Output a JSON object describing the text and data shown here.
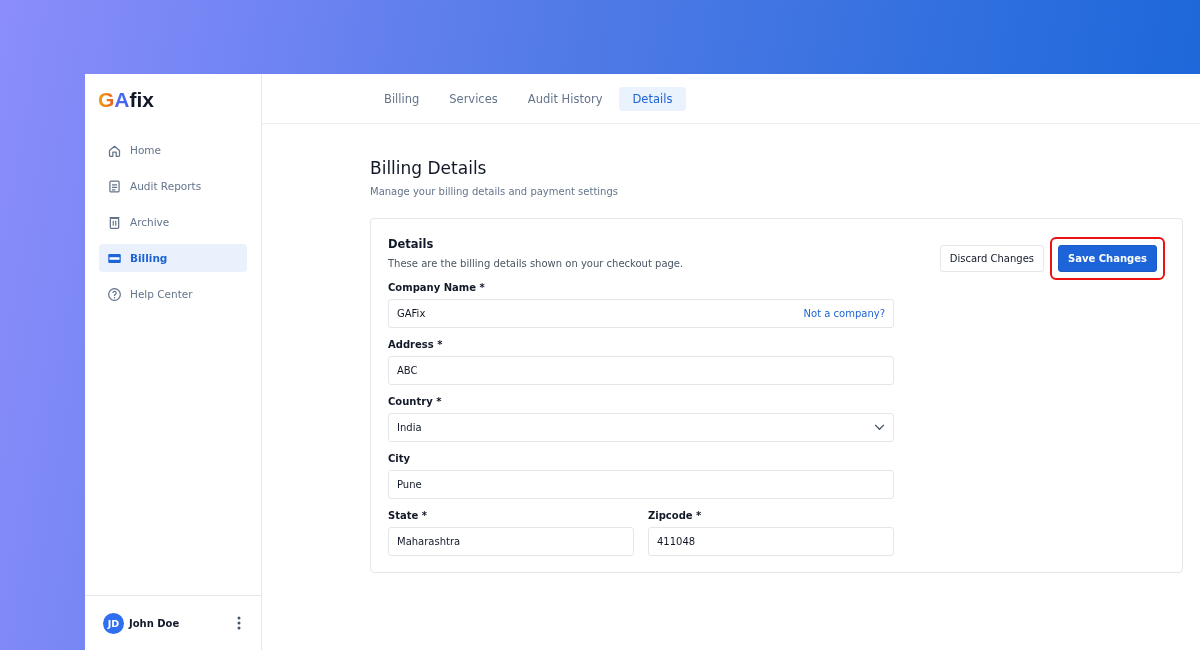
{
  "logo": {
    "mark": "GA",
    "word": "fix"
  },
  "sidebar": {
    "items": [
      {
        "label": "Home",
        "kind": "home",
        "selected": false
      },
      {
        "label": "Audit Reports",
        "kind": "doc",
        "selected": false
      },
      {
        "label": "Archive",
        "kind": "trash",
        "selected": false
      },
      {
        "label": "Billing",
        "kind": "card",
        "selected": true
      },
      {
        "label": "Help Center",
        "kind": "help",
        "selected": false
      }
    ],
    "user": {
      "initials": "JD",
      "name": "John Doe"
    }
  },
  "tabs": [
    {
      "label": "Billing",
      "selected": false
    },
    {
      "label": "Services",
      "selected": false
    },
    {
      "label": "Audit History",
      "selected": false
    },
    {
      "label": "Details",
      "selected": true
    }
  ],
  "page": {
    "title": "Billing Details",
    "subtitle": "Manage your billing details and payment settings"
  },
  "card": {
    "title": "Details",
    "description": "These are the billing details shown on your checkout page.",
    "buttons": [
      {
        "label": "Discard Changes",
        "kind": "secondary",
        "highlighted": false
      },
      {
        "label": "Save Changes",
        "kind": "primary",
        "highlighted": true
      }
    ],
    "rows": [
      [
        {
          "kind": "text",
          "label": "Company Name *",
          "value": "GAFix",
          "link": "Not a company?"
        }
      ],
      [
        {
          "kind": "text",
          "label": "Address *",
          "value": "ABC"
        }
      ],
      [
        {
          "kind": "select",
          "label": "Country *",
          "value": "India"
        }
      ],
      [
        {
          "kind": "text",
          "label": "City",
          "value": "Pune"
        }
      ],
      [
        {
          "kind": "text",
          "label": "State *",
          "value": "Maharashtra"
        },
        {
          "kind": "text",
          "label": "Zipcode *",
          "value": "411048"
        }
      ]
    ]
  }
}
